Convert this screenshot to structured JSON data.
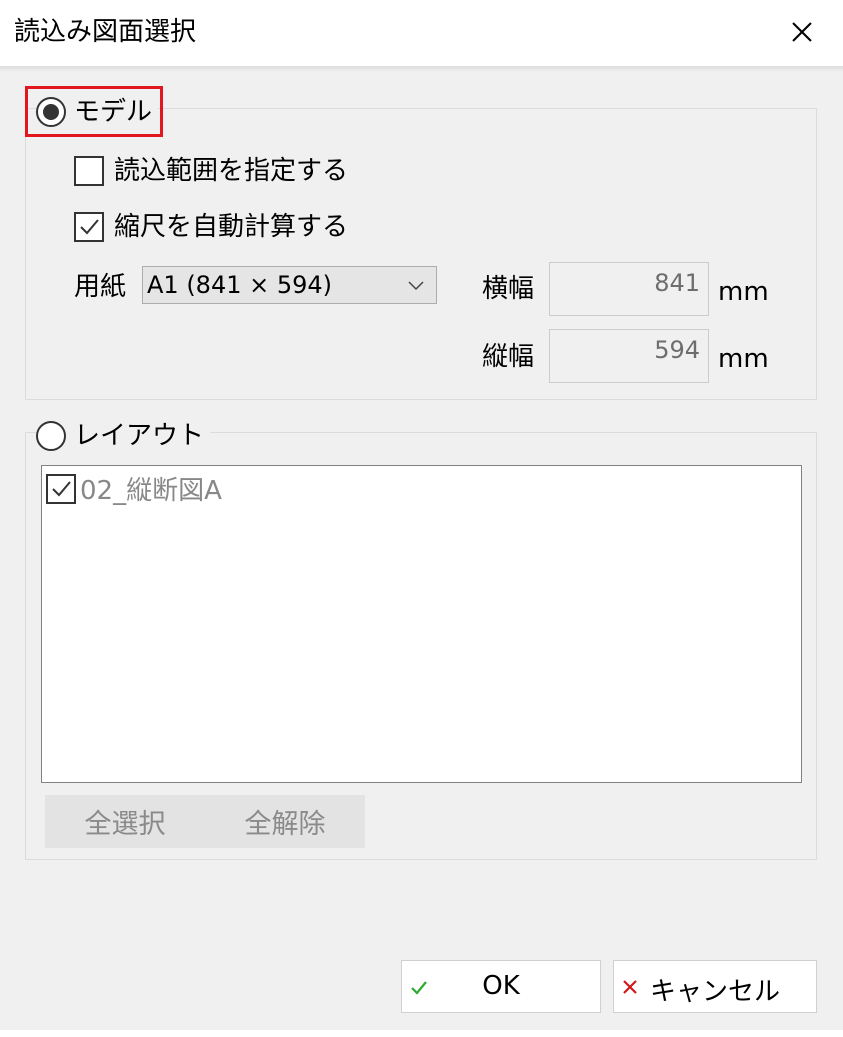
{
  "window": {
    "title": "読込み図面選択"
  },
  "model": {
    "label": "モデル",
    "selected": true,
    "range_checkbox": {
      "label": "読込範囲を指定する",
      "checked": false
    },
    "auto_scale_checkbox": {
      "label": "縮尺を自動計算する",
      "checked": true
    },
    "paper_label": "用紙",
    "paper_value": "A1 (841 × 594)",
    "width_label": "横幅",
    "width_value": "841",
    "height_label": "縦幅",
    "height_value": "594",
    "unit": "mm"
  },
  "layout": {
    "label": "レイアウト",
    "selected": false,
    "items": [
      {
        "label": "02_縦断図A",
        "checked": true
      }
    ],
    "select_all_label": "全選択",
    "deselect_all_label": "全解除"
  },
  "footer": {
    "ok_label": "OK",
    "cancel_label": "キャンセル"
  },
  "colors": {
    "focus_outline": "#e2161f",
    "ok_check": "#2fa82f",
    "cancel_x": "#d01818"
  }
}
